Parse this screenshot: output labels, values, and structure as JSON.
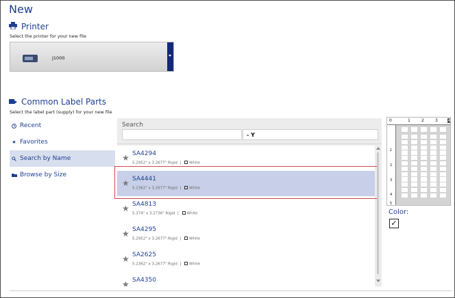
{
  "page": {
    "title": "New"
  },
  "printer": {
    "heading": "Printer",
    "subtitle": "Select the printer for your new file",
    "selected": "J1000",
    "icon": "printer-icon"
  },
  "label_parts": {
    "heading": "Common Label Parts",
    "subtitle": "Select the label part (supply) for your new file",
    "icon": "tape-icon"
  },
  "nav": [
    {
      "label": "Recent",
      "icon": "clock-icon",
      "active": false
    },
    {
      "label": "Favorites",
      "icon": "star-icon",
      "active": false
    },
    {
      "label": "Search by Name",
      "icon": "search-icon",
      "active": true
    },
    {
      "label": "Browse by Size",
      "icon": "folder-icon",
      "active": false
    }
  ],
  "search": {
    "label": "Search",
    "value": "",
    "filter": "- Y"
  },
  "parts": [
    {
      "name": "SA4294",
      "dims": "5.2952\" x 3.2677\" Rigid",
      "color": "White",
      "selected": false
    },
    {
      "name": "SA4441",
      "dims": "5.2362\" x 3.2677\" Rigid",
      "color": "White",
      "selected": true
    },
    {
      "name": "SA4813",
      "dims": "5.374\" x 3.2736\" Rigid",
      "color": "White",
      "selected": false
    },
    {
      "name": "SA4295",
      "dims": "5.2952\" x 3.2677\" Rigid",
      "color": "White",
      "selected": false
    },
    {
      "name": "SA2625",
      "dims": "5.2362\" x 3.2677\" Rigid",
      "color": "White",
      "selected": false
    },
    {
      "name": "SA4350",
      "dims": "",
      "color": "",
      "selected": false
    }
  ],
  "preview": {
    "ruler_top": [
      "0",
      "1",
      "2",
      "3",
      "4"
    ],
    "ruler_left": [
      "1",
      "2",
      "3",
      "4",
      "5"
    ],
    "color_label": "Color:",
    "color_checked": true,
    "check_glyph": "✓"
  },
  "colors": {
    "accent": "#1d3f91",
    "selected_row": "#c7d0e8",
    "highlight_border": "#d34747",
    "dropdown": "#14287a"
  }
}
